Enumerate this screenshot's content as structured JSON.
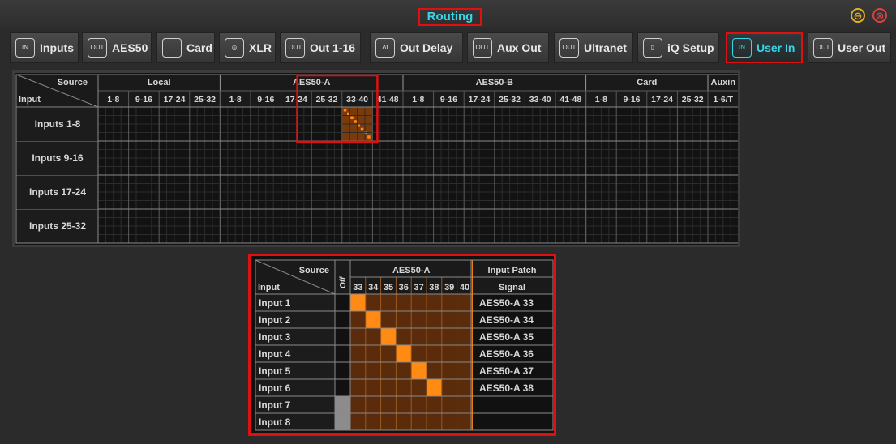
{
  "window": {
    "title": "Routing",
    "minimize_symbol": "⊖",
    "close_symbol": "⊗"
  },
  "tabs": [
    {
      "label": "Inputs",
      "icon": "input-jack-icon",
      "icon_text": "IN"
    },
    {
      "label": "AES50",
      "icon": "output-jack-icon",
      "icon_text": "OUT"
    },
    {
      "label": "Card",
      "icon": "card-icon",
      "icon_text": ""
    },
    {
      "label": "XLR",
      "icon": "xlr-icon",
      "icon_text": "◎"
    },
    {
      "label": "Out 1-16",
      "icon": "output-jack-icon",
      "icon_text": "OUT"
    },
    {
      "label": "Out Delay",
      "icon": "delay-icon",
      "icon_text": "Δt"
    },
    {
      "label": "Aux Out",
      "icon": "output-jack-icon",
      "icon_text": "OUT"
    },
    {
      "label": "Ultranet",
      "icon": "output-jack-icon",
      "icon_text": "OUT"
    },
    {
      "label": "iQ Setup",
      "icon": "speaker-icon",
      "icon_text": "▯"
    },
    {
      "label": "User In",
      "icon": "input-jack-icon",
      "icon_text": "IN",
      "active": true
    },
    {
      "label": "User Out",
      "icon": "output-jack-icon",
      "icon_text": "OUT"
    }
  ],
  "matrix": {
    "corner_source": "Source",
    "corner_input": "Input",
    "groups": [
      {
        "name": "Local",
        "cols": [
          "1-8",
          "9-16",
          "17-24",
          "25-32"
        ]
      },
      {
        "name": "AES50-A",
        "cols": [
          "1-8",
          "9-16",
          "17-24",
          "25-32",
          "33-40",
          "41-48"
        ]
      },
      {
        "name": "AES50-B",
        "cols": [
          "1-8",
          "9-16",
          "17-24",
          "25-32",
          "33-40",
          "41-48"
        ]
      },
      {
        "name": "Card",
        "cols": [
          "1-8",
          "9-16",
          "17-24",
          "25-32"
        ]
      },
      {
        "name": "Auxin",
        "cols": [
          "1-6/T"
        ]
      }
    ],
    "rows": [
      "Inputs 1-8",
      "Inputs 9-16",
      "Inputs 17-24",
      "Inputs 25-32"
    ],
    "active_block": {
      "row": 0,
      "group": "AES50-A",
      "col": "33-40"
    }
  },
  "detail": {
    "corner_source": "Source",
    "corner_input": "Input",
    "off_label": "Off",
    "group": "AES50-A",
    "channels": [
      "33",
      "34",
      "35",
      "36",
      "37",
      "38",
      "39",
      "40"
    ],
    "patch_header": "Input Patch",
    "signal_header": "Signal",
    "rows": [
      {
        "input": "Input 1",
        "signal": "AES50-A 33",
        "patched_channel": 0
      },
      {
        "input": "Input 2",
        "signal": "AES50-A 34",
        "patched_channel": 1
      },
      {
        "input": "Input 3",
        "signal": "AES50-A 35",
        "patched_channel": 2
      },
      {
        "input": "Input 4",
        "signal": "AES50-A 36",
        "patched_channel": 3
      },
      {
        "input": "Input 5",
        "signal": "AES50-A 37",
        "patched_channel": 4
      },
      {
        "input": "Input 6",
        "signal": "AES50-A 38",
        "patched_channel": 5
      },
      {
        "input": "Input 7",
        "signal": "",
        "patched_channel": -1
      },
      {
        "input": "Input 8",
        "signal": "",
        "patched_channel": -1
      }
    ]
  },
  "colors": {
    "accent": "#38d6e8",
    "highlight": "#e01010",
    "patch": "#ff8a14",
    "patch_dim": "#5a2c0c",
    "off": "#8c8c8c"
  }
}
